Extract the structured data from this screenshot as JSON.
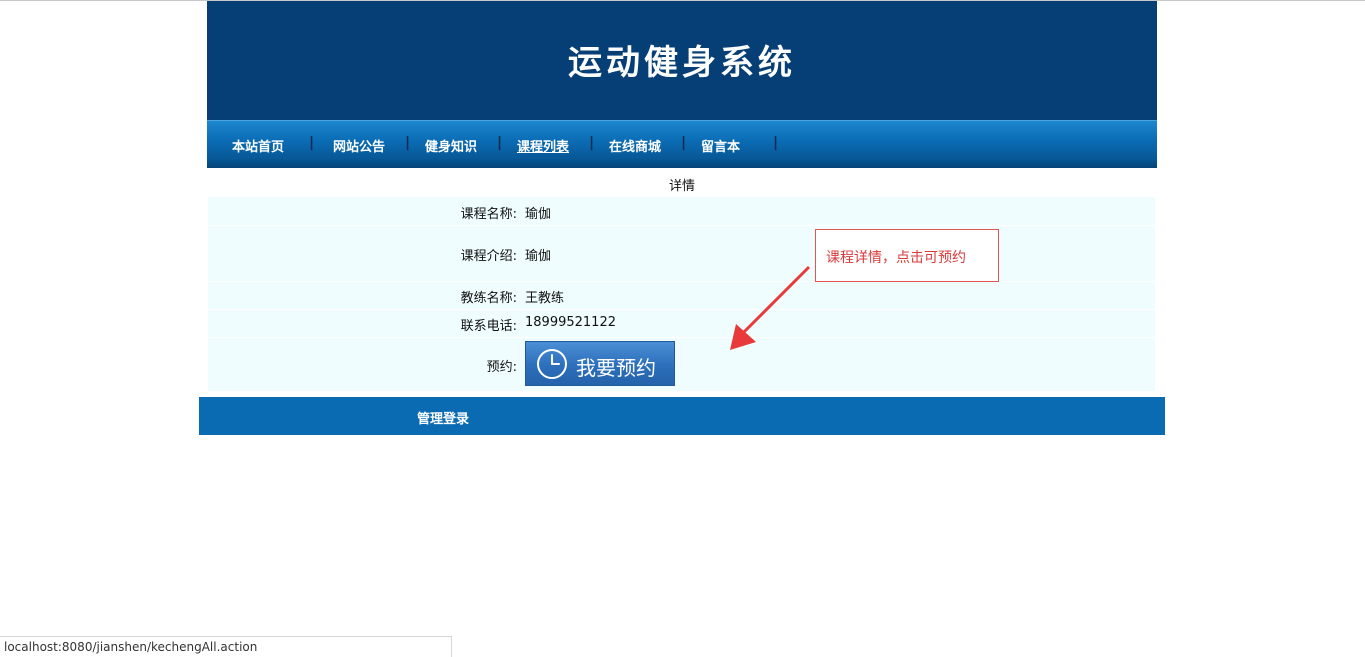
{
  "site": {
    "title": "运动健身系统"
  },
  "nav": {
    "items": [
      {
        "label": "本站首页"
      },
      {
        "label": "网站公告"
      },
      {
        "label": "健身知识"
      },
      {
        "label": "课程列表"
      },
      {
        "label": "在线商城"
      },
      {
        "label": "留言本"
      }
    ],
    "separator": "|",
    "active_index": 3
  },
  "detail": {
    "heading": "详情",
    "rows": [
      {
        "label": "课程名称:",
        "value": "瑜伽"
      },
      {
        "label": "课程介绍:",
        "value": "瑜伽"
      },
      {
        "label": "教练名称:",
        "value": "王教练"
      },
      {
        "label": "联系电话:",
        "value": "18999521122"
      },
      {
        "label": "预约:"
      }
    ],
    "book_button_label": "我要预约"
  },
  "footer": {
    "admin_login": "管理登录"
  },
  "annotation": {
    "callout_text": "课程详情，点击可预约"
  },
  "statusbar": {
    "url": "localhost:8080/jianshen/kechengAll.action"
  },
  "colors": {
    "header_bg": "#063f75",
    "nav_bg": "#0b6db6",
    "footer_bg": "#0a6bb3",
    "table_bg": "#f0fdff",
    "callout_red": "#d93a3a",
    "button_blue": "#2d6fbb"
  },
  "icons": {
    "book_button": "clock-icon",
    "annotation": "arrow-icon"
  }
}
